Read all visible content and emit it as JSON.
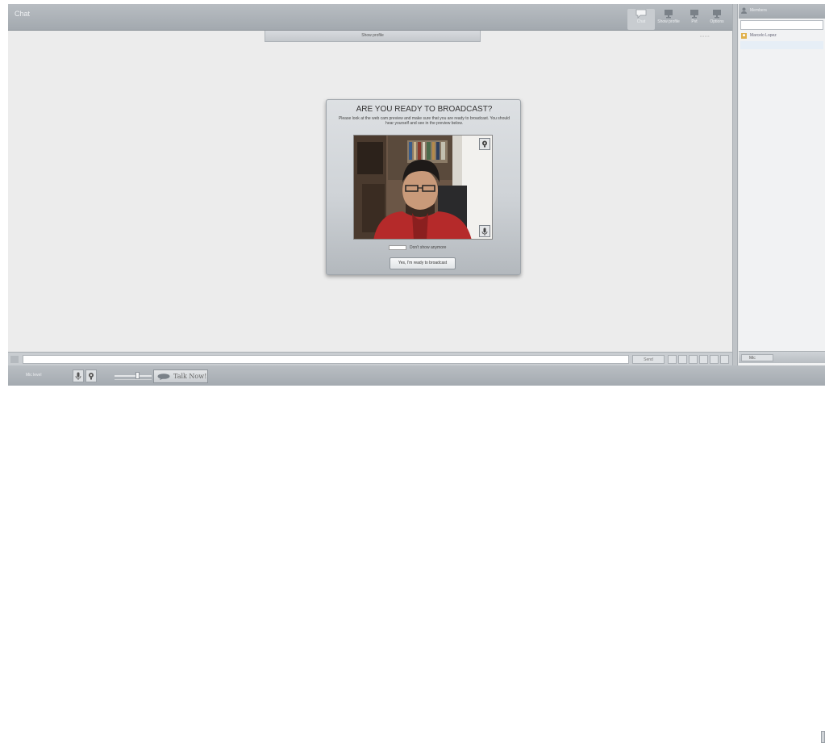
{
  "app": {
    "title": "Chat"
  },
  "toolbar": {
    "items": [
      {
        "label": "Chat",
        "icon": "speech-bubble-icon"
      },
      {
        "label": "Show profile",
        "icon": "monitor-icon"
      },
      {
        "label": "Pvt",
        "icon": "monitor-icon"
      },
      {
        "label": "Options",
        "icon": "monitor-icon"
      }
    ]
  },
  "profile_tab": {
    "label": "Show profile"
  },
  "sidebar": {
    "header_label": "Members",
    "search_placeholder": "",
    "members": [
      {
        "name": "Marcelo Lopez"
      }
    ],
    "footer_button": "Mic"
  },
  "input_bar": {
    "send_label": "Send"
  },
  "bottom_bar": {
    "label": "Mic level",
    "talk_button": "Talk Now!",
    "volume_level": 0.6
  },
  "modal": {
    "title": "ARE YOU READY TO BROADCAST?",
    "description": "Please look at the web cam preview and make sure that you are ready to broadcast. You should hear yourself and see in the preview below.",
    "checkbox_label": "Don't show anymore",
    "confirm_button": "Yes, I'm ready to broadcast"
  },
  "colors": {
    "bar": "#a8aeb4",
    "background": "#e9eaeb",
    "modal": "#cfd3d7"
  }
}
